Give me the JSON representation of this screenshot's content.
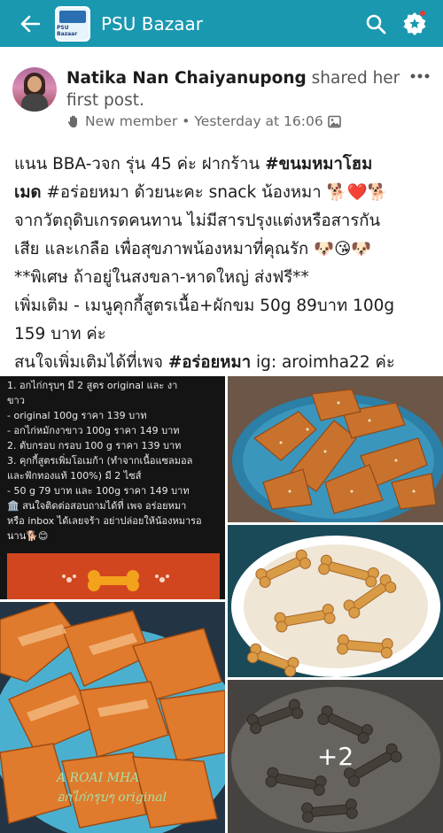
{
  "appbar": {
    "title": "PSU Bazaar",
    "logo_text": "PSU Bazaar",
    "colors": {
      "bar": "#1a98b0",
      "notification_dot": "#e53935"
    },
    "icons": [
      "back-arrow-icon",
      "search-icon",
      "badge-star-icon"
    ]
  },
  "post": {
    "author": "Natika Nan Chaiyanupong",
    "action": " shared her first post.",
    "meta": {
      "member_status": "New member",
      "separator": "•",
      "time": "Yesterday at 16:06",
      "icons": [
        "waving-hand-icon",
        "photo-icon"
      ]
    },
    "text_lines": [
      {
        "pre": "แนน BBA-วจก รุ่น 45 ค่ะ ฝากร้าน ",
        "bold": "#ขนมหมาโฮม",
        "post": ""
      },
      {
        "pre": "",
        "bold": "เมด",
        "post": " #อร่อยหมา ด้วยนะคะ snack น้องหมา 🐕❤️🐕"
      },
      {
        "pre": "จากวัตถุดิบเกรดคนทาน ไม่มีสารปรุงแต่งหรือสารกัน",
        "bold": "",
        "post": ""
      },
      {
        "pre": "เสีย และเกลือ เพื่อสุขภาพน้องหมาที่คุณรัก 🐶😘🐶",
        "bold": "",
        "post": ""
      },
      {
        "pre": "**พิเศษ ถ้าอยู่ในสงขลา-หาดใหญ่ ส่งฟรี**",
        "bold": "",
        "post": ""
      },
      {
        "pre": "เพิ่มเติม - เมนูคุกกี้สูตรเนื้อ+ผักขม 50g 89บาท 100g",
        "bold": "",
        "post": ""
      },
      {
        "pre": "159 บาท ค่ะ",
        "bold": "",
        "post": ""
      },
      {
        "pre": "สนใจเพิ่มเติมได้ที่เพจ ",
        "bold": "#อร่อยหมา",
        "post": " ig: aroimha22 ค่ะ"
      }
    ]
  },
  "photos": {
    "menu_lines": [
      "1. อกไก่กรุบๆ มี 2 สูตร original และ งา",
      "   ขาว",
      "   - original 100g ราคา 139 บาท",
      "   - อกไก่หมักงาขาว 100g ราคา 149 บาท",
      "2. ตับกรอบ กรอบ  100 g ราคา 139 บาท",
      "3. คุกกี้สูตรเพิ่มโอเมก้า (ทำจากเนื้อแซลมอล",
      "   และฟักทองแท้ 100%) มี 2 ไซส์",
      "   - 50 g 79 บาท  และ 100g ราคา 149 บาท",
      "🏛️ สนใจติดต่อสอบถามได้ที่ เพจ อร่อยหมา",
      "หรือ inbox ได้เลยจร้า อย่าปล่อยให้น้องหมารอ",
      "นาน🐕😊"
    ],
    "watermark_line1": "A ROAI MHA",
    "watermark_line2": "อกไก่กรุบๆ original",
    "more_count": "+2",
    "photo_subjects": [
      "menu-card",
      "chicken-jerky-plate",
      "bone-cookies-plate",
      "chicken-jerky-closeup",
      "dark-bone-cookies"
    ]
  }
}
